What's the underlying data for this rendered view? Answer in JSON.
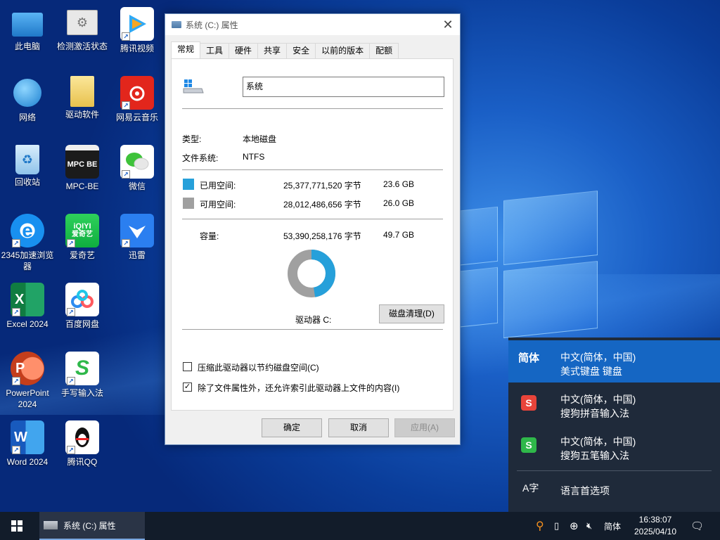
{
  "desktop": {
    "icons": [
      {
        "label": "此电脑"
      },
      {
        "label": "检测激活状态"
      },
      {
        "label": "腾讯视频"
      },
      {
        "label": "网络"
      },
      {
        "label": "驱动软件"
      },
      {
        "label": "网易云音乐"
      },
      {
        "label": "回收站"
      },
      {
        "label": "MPC-BE"
      },
      {
        "label": "微信"
      },
      {
        "label": "2345加速浏览器"
      },
      {
        "label": "爱奇艺"
      },
      {
        "label": "迅雷"
      },
      {
        "label": "Excel 2024"
      },
      {
        "label": "百度网盘"
      },
      {
        "label": "PowerPoint 2024"
      },
      {
        "label": "手写输入法"
      },
      {
        "label": "Word 2024"
      },
      {
        "label": "腾讯QQ"
      }
    ],
    "icon_glyphs": {
      "mpc": "MPC BE",
      "iqiyi": "iQIYI",
      "iqiyi_sub": "爱奇艺",
      "excel": "X",
      "ppt": "P",
      "word": "W",
      "sogou": "S"
    }
  },
  "dialog": {
    "title": "系统 (C:) 属性",
    "tabs": [
      "常规",
      "工具",
      "硬件",
      "共享",
      "安全",
      "以前的版本",
      "配额"
    ],
    "name_value": "系统",
    "type_label": "类型:",
    "type_value": "本地磁盘",
    "fs_label": "文件系统:",
    "fs_value": "NTFS",
    "used_label": "已用空间:",
    "used_bytes": "25,377,771,520 字节",
    "used_gb": "23.6 GB",
    "free_label": "可用空间:",
    "free_bytes": "28,012,486,656 字节",
    "free_gb": "26.0 GB",
    "cap_label": "容量:",
    "cap_bytes": "53,390,258,176 字节",
    "cap_gb": "49.7 GB",
    "used_fraction": 0.475,
    "drive_label": "驱动器 C:",
    "cleanup_button": "磁盘清理(D)",
    "compress_label": "压缩此驱动器以节约磁盘空间(C)",
    "compress_checked": false,
    "index_label": "除了文件属性外，还允许索引此驱动器上文件的内容(I)",
    "index_checked": true,
    "ok": "确定",
    "cancel": "取消",
    "apply": "应用(A)",
    "colors": {
      "used": "#26a0da",
      "free": "#a0a0a0"
    }
  },
  "language_popup": {
    "items": [
      {
        "abbr": "简体",
        "line1": "中文(简体，中国)",
        "line2": "美式键盘 键盘"
      },
      {
        "line1": "中文(简体，中国)",
        "line2": "搜狗拼音输入法"
      },
      {
        "line1": "中文(简体，中国)",
        "line2": "搜狗五笔输入法"
      }
    ],
    "prefs_label": "语言首选项",
    "prefs_icon": "A字"
  },
  "taskbar": {
    "app_title": "系统 (C:) 属性",
    "ime": "简体",
    "time": "16:38:07",
    "date": "2025/04/10"
  }
}
